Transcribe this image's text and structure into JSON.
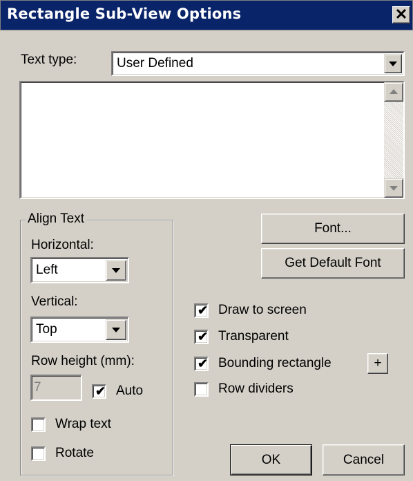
{
  "window": {
    "title": "Rectangle Sub-View Options",
    "close_glyph": "✕"
  },
  "text_type": {
    "label": "Text type:",
    "value": "User Defined"
  },
  "text_area": {
    "value": ""
  },
  "align_text": {
    "group_label": "Align Text",
    "horizontal_label": "Horizontal:",
    "horizontal_value": "Left",
    "vertical_label": "Vertical:",
    "vertical_value": "Top",
    "row_height_label": "Row height (mm):",
    "row_height_value": "7",
    "auto_label": "Auto",
    "auto_checked": true,
    "wrap_text_label": "Wrap text",
    "wrap_text_checked": false,
    "rotate_label": "Rotate",
    "rotate_checked": false
  },
  "buttons": {
    "font": "Font...",
    "get_default_font": "Get Default Font",
    "plus": "+",
    "ok": "OK",
    "cancel": "Cancel"
  },
  "options": {
    "draw_to_screen_label": "Draw to screen",
    "draw_to_screen_checked": true,
    "transparent_label": "Transparent",
    "transparent_checked": true,
    "bounding_rectangle_label": "Bounding rectangle",
    "bounding_rectangle_checked": true,
    "row_dividers_label": "Row dividers",
    "row_dividers_checked": false
  },
  "check_glyph": "✔"
}
